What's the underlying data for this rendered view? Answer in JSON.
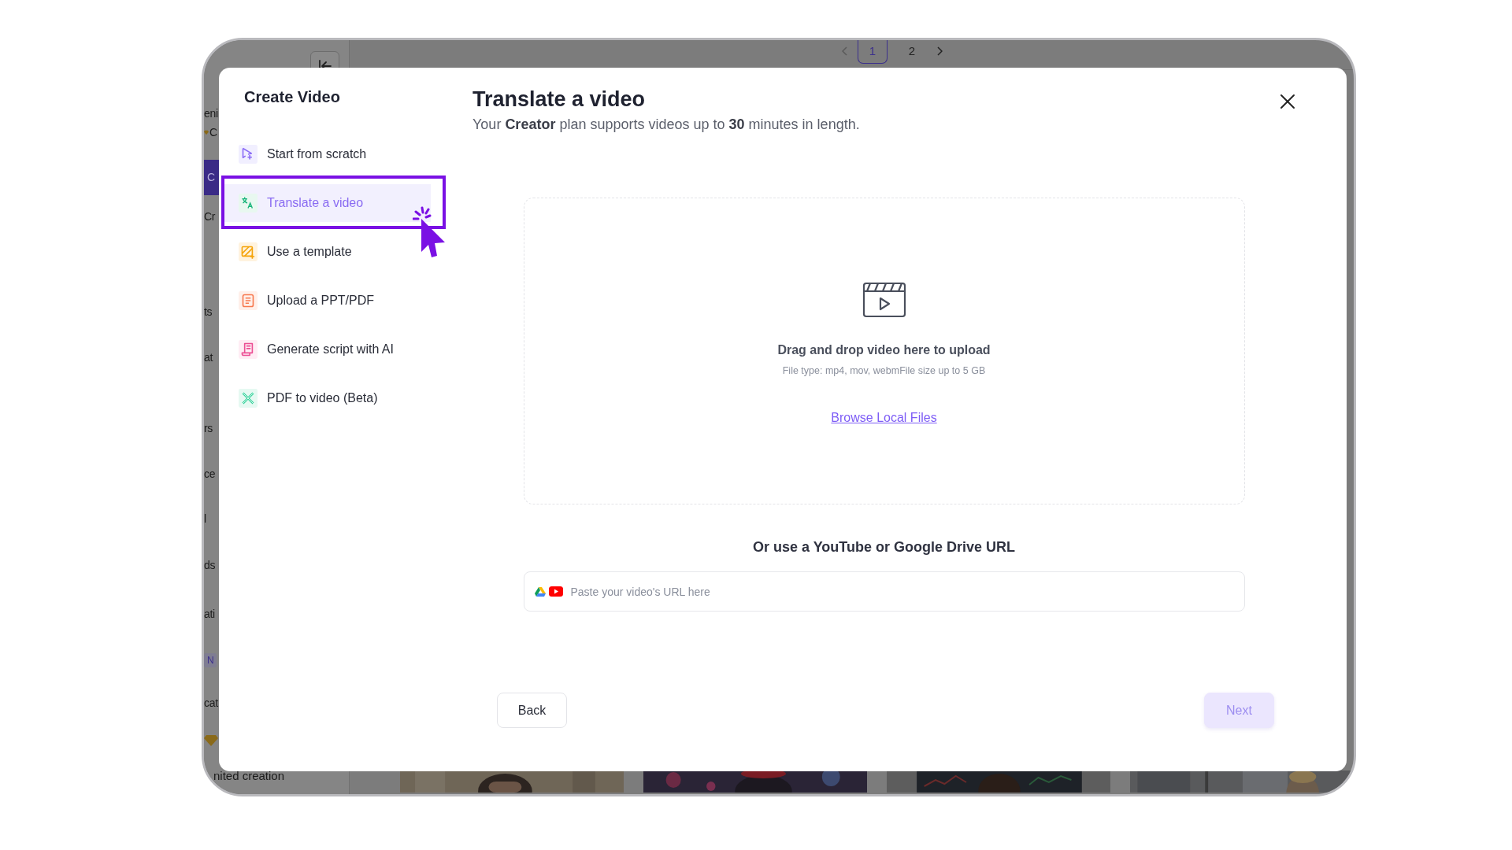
{
  "background_app": {
    "sidebar_fragments": [
      {
        "kind": "text",
        "text": "eni"
      },
      {
        "kind": "plan",
        "text": "C"
      },
      {
        "kind": "button",
        "text": "C"
      },
      {
        "kind": "text",
        "text": "Cr"
      },
      {
        "kind": "text",
        "text": "ts"
      },
      {
        "kind": "text",
        "text": "at"
      },
      {
        "kind": "text",
        "text": "rs"
      },
      {
        "kind": "text",
        "text": "ce"
      },
      {
        "kind": "text",
        "text": "l"
      },
      {
        "kind": "text",
        "text": "ds"
      },
      {
        "kind": "text",
        "text": "ati"
      },
      {
        "kind": "badge",
        "text": "N"
      },
      {
        "kind": "text",
        "text": "cat"
      },
      {
        "kind": "upgrade"
      },
      {
        "kind": "text",
        "text": "nited creation"
      }
    ],
    "pagination": {
      "pages": [
        {
          "label": "1",
          "selected": true
        },
        {
          "label": "2",
          "selected": false
        }
      ]
    }
  },
  "modal": {
    "title": "Create Video",
    "menu": [
      {
        "kind": "scratch",
        "label": "Start from scratch",
        "selected": false,
        "highlighted": false
      },
      {
        "kind": "translate",
        "label": "Translate a video",
        "selected": true,
        "highlighted": true
      },
      {
        "kind": "template",
        "label": "Use a template",
        "selected": false,
        "highlighted": false
      },
      {
        "kind": "upload",
        "label": "Upload a PPT/PDF",
        "selected": false,
        "highlighted": false
      },
      {
        "kind": "script",
        "label": "Generate script with AI",
        "selected": false,
        "highlighted": false
      },
      {
        "kind": "pdf",
        "label": "PDF to video (Beta)",
        "selected": false,
        "highlighted": false
      }
    ],
    "heading": "Translate a video",
    "subtitle": "Your **Creator** plan supports videos up to **30** minutes in length.",
    "dropzone": {
      "title": "Drag and drop video here to upload",
      "hint": "File type: mp4, mov, webmFile size up to 5 GB",
      "link": "Browse Local Files"
    },
    "url_section": {
      "title": "Or use a YouTube or Google Drive URL",
      "placeholder": "Paste your video's URL here"
    },
    "buttons": [
      {
        "label": "Back",
        "disabled": false
      },
      {
        "label": "Next",
        "disabled": true
      }
    ]
  }
}
